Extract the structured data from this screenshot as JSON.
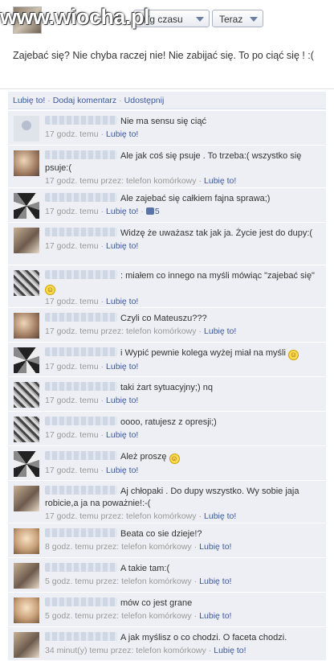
{
  "watermark": "www.wiocha.pl",
  "header": {
    "sort_label": "Wg czasu",
    "time_label": "Teraz"
  },
  "post": {
    "text": "Zajebać się? Nie chyba raczej nie! Nie zabijać się. To po ciąć się ! :("
  },
  "actions": {
    "like": "Lubię to!",
    "comment": "Dodaj komentarz",
    "share": "Udostępnij"
  },
  "comments": [
    {
      "text": "Nie ma sensu się ciąć",
      "time": "17 godz. temu",
      "via": "",
      "like": "Lubię to!",
      "likes": "",
      "smiley": false
    },
    {
      "text": "Ale jak coś się psuje . To trzeba:( wszystko się psuje:(",
      "time": "17 godz. temu przez: telefon komórkowy",
      "via": "",
      "like": "Lubię to!",
      "likes": "",
      "smiley": false
    },
    {
      "text": "Ale zajebać się całkiem fajna sprawa;)",
      "time": "17 godz. temu",
      "via": "",
      "like": "Lubię to!",
      "likes": "5",
      "smiley": false
    },
    {
      "text": "Widzę że uważasz tak jak ja. Życie jest do dupy:(",
      "time": "17 godz. temu",
      "via": "",
      "like": "Lubię to!",
      "likes": "",
      "smiley": false
    },
    {
      "text": ": miałem co innego na myśli mówiąc \"zajebać się\"",
      "time": "17 godz. temu",
      "via": "",
      "like": "Lubię to!",
      "likes": "",
      "smiley": true
    },
    {
      "text": "Czyli co Mateuszu???",
      "time": "17 godz. temu przez: telefon komórkowy",
      "via": "",
      "like": "Lubię to!",
      "likes": "",
      "smiley": false
    },
    {
      "text": "i Wypić pewnie kolega wyżej miał na myśli",
      "time": "17 godz. temu",
      "via": "",
      "like": "Lubię to!",
      "likes": "",
      "smiley": true
    },
    {
      "text": "taki żart sytuacyjny;) nq",
      "time": "17 godz. temu",
      "via": "",
      "like": "Lubię to!",
      "likes": "",
      "smiley": false
    },
    {
      "text": "oooo, ratujesz z opresji;)",
      "time": "17 godz. temu",
      "via": "",
      "like": "Lubię to!",
      "likes": "",
      "smiley": false
    },
    {
      "text": "Ależ proszę",
      "time": "17 godz. temu",
      "via": "",
      "like": "Lubię to!",
      "likes": "",
      "smiley": true
    },
    {
      "text": "Aj chłopaki . Do dupy wszystko. Wy sobie jaja robicie,a ja na poważnie!:-(",
      "time": "17 godz. temu przez: telefon komórkowy",
      "via": "",
      "like": "Lubię to!",
      "likes": "",
      "smiley": false
    },
    {
      "text": "Beata co sie dzieje!?",
      "time": "8 godz. temu przez: telefon komórkowy",
      "via": "",
      "like": "Lubię to!",
      "likes": "",
      "smiley": false
    },
    {
      "text": "A takie tam:(",
      "time": "5 godz. temu przez: telefon komórkowy",
      "via": "",
      "like": "Lubię to!",
      "likes": "",
      "smiley": false
    },
    {
      "text": "mów co jest grane",
      "time": "5 godz. temu przez: telefon komórkowy",
      "via": "",
      "like": "Lubię to!",
      "likes": "",
      "smiley": false
    },
    {
      "text": "A jak myślisz o co chodzi. O faceta chodzi.",
      "time": "34 minut(y) temu przez: telefon komórkowy",
      "via": "",
      "like": "Lubię to!",
      "likes": "",
      "smiley": false
    }
  ]
}
